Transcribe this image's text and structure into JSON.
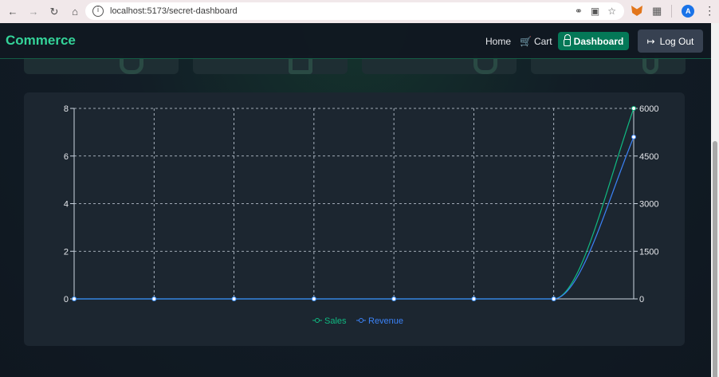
{
  "browser": {
    "url": "localhost:5173/secret-dashboard",
    "back_icon": "arrow-left-icon",
    "forward_icon": "arrow-right-icon",
    "reload_icon": "reload-icon",
    "home_icon": "home-icon",
    "avatar_letter": "A"
  },
  "nav": {
    "brand": "Commerce",
    "home": "Home",
    "cart": "Cart",
    "dashboard": "Dashboard",
    "logout": "Log Out"
  },
  "colors": {
    "brand": "#34d399",
    "sales": "#10b981",
    "revenue": "#3b82f6",
    "dashboard_button": "#047857"
  },
  "chart_data": {
    "type": "line",
    "x": [
      "",
      "",
      "",
      "",
      "",
      "",
      "",
      ""
    ],
    "series": [
      {
        "name": "Sales",
        "axis": "left",
        "values": [
          0,
          0,
          0,
          0,
          0,
          0,
          0,
          8
        ]
      },
      {
        "name": "Revenue",
        "axis": "right",
        "values": [
          0,
          0,
          0,
          0,
          0,
          0,
          0,
          5100
        ]
      }
    ],
    "left_axis": {
      "ylim": [
        0,
        8
      ],
      "ticks": [
        "0",
        "2",
        "4",
        "6",
        "8"
      ]
    },
    "right_axis": {
      "ylim": [
        0,
        6000
      ],
      "ticks": [
        "0",
        "1500",
        "3000",
        "4500",
        "6000"
      ]
    },
    "grid": true,
    "legend": "bottom"
  }
}
